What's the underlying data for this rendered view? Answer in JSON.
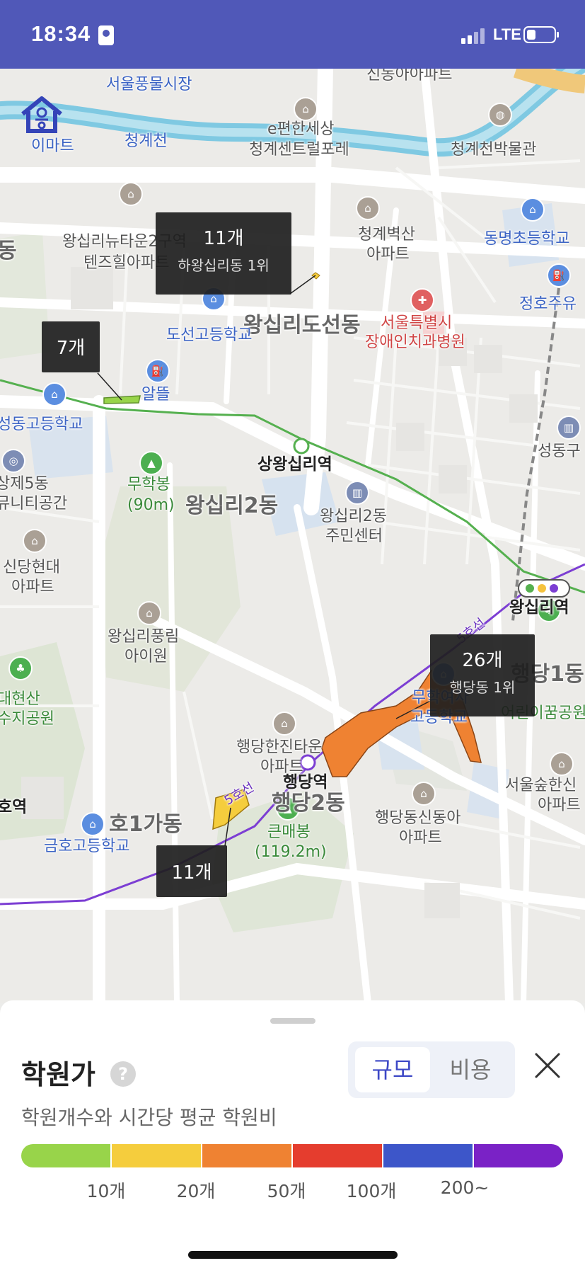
{
  "status_bar": {
    "time": "18:34",
    "network": "LTE"
  },
  "map": {
    "labels": {
      "seoul_pungmul_market": "서울풍물시장",
      "emart": "이마트",
      "cheonggyecheon": "청계천",
      "shindong_apt": "신동아아파트",
      "epyeonhan": "e편한세상",
      "cheonggye_central": "청계센트럴포레",
      "cheonggye_museum": "청계천박물관",
      "newtown_2": "왕십리뉴타운2구역",
      "tenzhill": "텐즈힐아파트",
      "dong_left": "동",
      "cheonggye_byeoksan": "청계벽산",
      "apt": "아파트",
      "dongmyeong_school": "동명초등학교",
      "jeongho": "정호주유",
      "wangsimni_doseon": "왕십리도선동",
      "doseon_high": "도선고등학교",
      "seoul_dental": "서울특별시",
      "seoul_dental_2": "장애인치과병원",
      "altteul": "알뜰",
      "sangwangsimni_station": "상왕십리역",
      "seongdong_high": "성동고등학교",
      "seongdong_gu": "성동구",
      "muhakbong": "무학봉",
      "muhakbong_height": "(90m)",
      "wangsimni_2dong": "왕십리2동",
      "community_center": "왕십리2동",
      "community_center_2": "주민센터",
      "wangsimni_station": "왕십리역",
      "sangje_5": "상제5동",
      "community_space": "뮤니티공간",
      "sindang_hyundai": "신당현대",
      "sindang_apt": "아파트",
      "haengdang1": "행당1동",
      "eorini_park": "어린이꿈공원",
      "wangsimni_pungnim": "왕십리풍림",
      "aiwon": "아이원",
      "daehyeon": "대현산",
      "reservoir_park": "수지공원",
      "haengdang_station": "행당역",
      "haengdang2": "행당2동",
      "muhak_girls": "무학여자",
      "muhak_girls_2": "고등학교",
      "hanjin_town": "행당한진타운",
      "hanjin_apt": "아파트",
      "seoul_forest": "서울숲한신",
      "seoul_forest_apt": "아파트",
      "geumho_station": "호역",
      "geumho_1ga": "호1가동",
      "geumho_high": "금호고등학교",
      "keunmaebong": "큰매봉",
      "keunmaebong_height": "(119.2m)",
      "shindonga": "행당동신동아",
      "shindonga_apt": "아파트",
      "line_5": "5호선",
      "line_5b": "5호선"
    },
    "callouts": [
      {
        "count": "11개",
        "rank": "하왕십리동 1위"
      },
      {
        "count": "7개",
        "rank": ""
      },
      {
        "count": "26개",
        "rank": "행당동 1위"
      },
      {
        "count": "11개",
        "rank": ""
      }
    ]
  },
  "panel": {
    "title": "학원가",
    "subtitle": "학원개수와 시간당 평균 학원비",
    "toggle": {
      "size_label": "규모",
      "cost_label": "비용",
      "selected": "규모"
    },
    "scale": {
      "colors": [
        "#98d44a",
        "#f5cd3d",
        "#ef8232",
        "#e53d2e",
        "#3d56c9",
        "#7a22c6"
      ],
      "labels": [
        "10개",
        "20개",
        "50개",
        "100개",
        "200~"
      ]
    }
  }
}
